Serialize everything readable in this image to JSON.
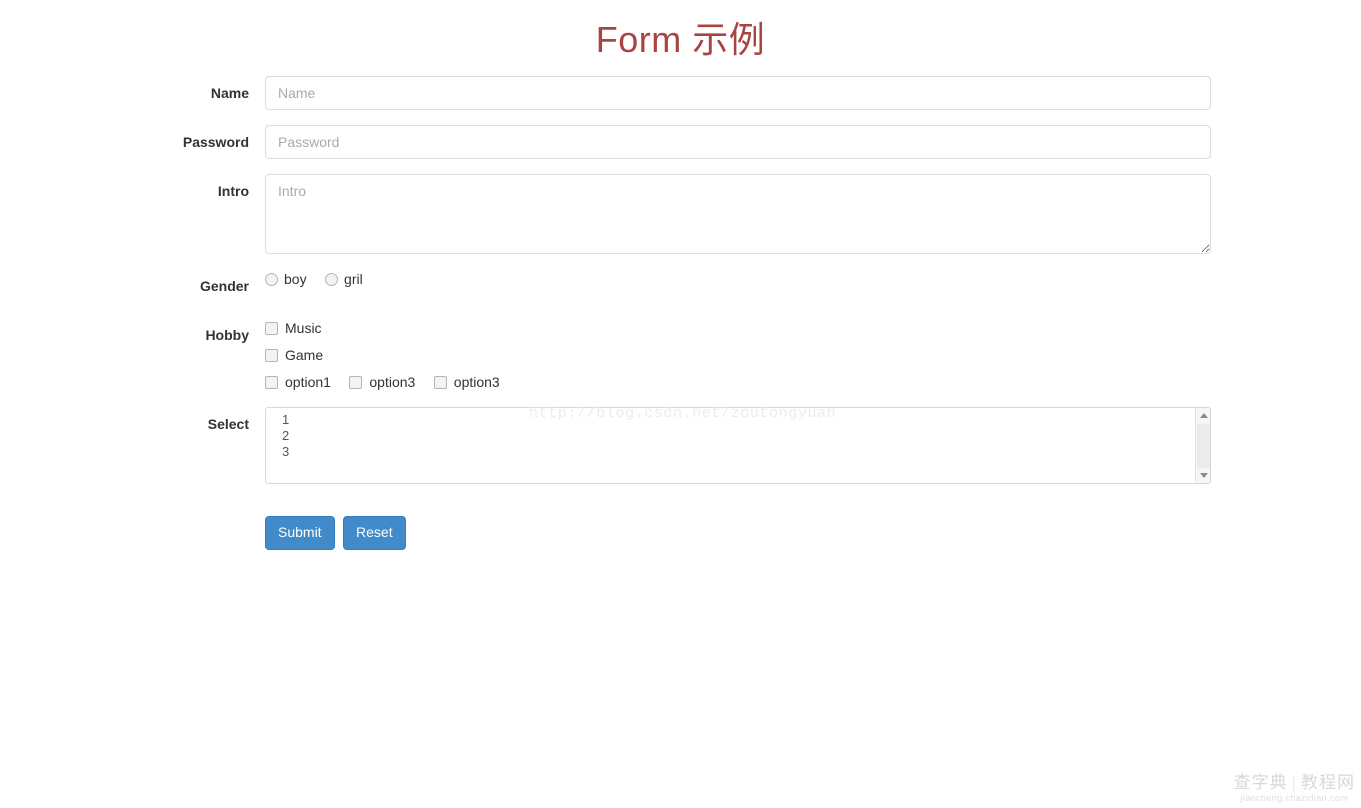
{
  "title": "Form 示例",
  "form": {
    "fields": [
      {
        "label": "Name",
        "placeholder": "Name",
        "type": "text"
      },
      {
        "label": "Password",
        "placeholder": "Password",
        "type": "text"
      },
      {
        "label": "Intro",
        "placeholder": "Intro",
        "type": "textarea"
      }
    ],
    "gender": {
      "label": "Gender",
      "options": [
        {
          "label": "boy",
          "checked": false
        },
        {
          "label": "gril",
          "checked": false
        }
      ]
    },
    "hobby": {
      "label": "Hobby",
      "stacked": [
        {
          "label": "Music",
          "checked": false
        },
        {
          "label": "Game",
          "checked": false
        }
      ],
      "inline": [
        {
          "label": "option1",
          "checked": false
        },
        {
          "label": "option3",
          "checked": false
        },
        {
          "label": "option3",
          "checked": false
        }
      ]
    },
    "select": {
      "label": "Select",
      "options": [
        "1",
        "2",
        "3"
      ]
    },
    "buttons": {
      "submit": "Submit",
      "reset": "Reset"
    }
  },
  "watermarks": {
    "url": "http://blog.csdn.net/zoutongyuan",
    "logo_left": "查字典",
    "logo_bar": "|",
    "logo_right": "教程网",
    "logo_sub": "jiaocheng.chazidian.com"
  },
  "colors": {
    "title": "#a94442",
    "button": "#428bca",
    "border": "#dcdcdc",
    "placeholder": "#aaaaaa"
  }
}
